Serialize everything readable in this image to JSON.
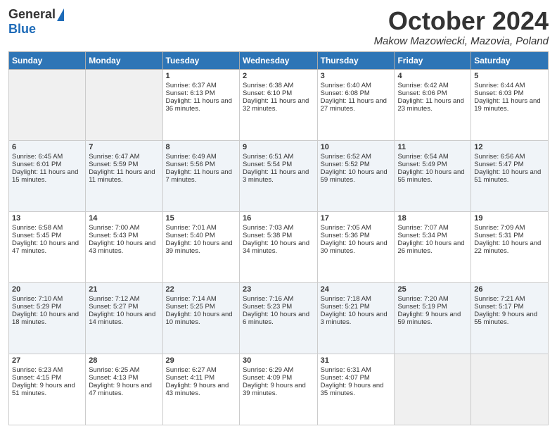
{
  "logo": {
    "general": "General",
    "blue": "Blue"
  },
  "header": {
    "month": "October 2024",
    "location": "Makow Mazowiecki, Mazovia, Poland"
  },
  "weekdays": [
    "Sunday",
    "Monday",
    "Tuesday",
    "Wednesday",
    "Thursday",
    "Friday",
    "Saturday"
  ],
  "weeks": [
    [
      {
        "day": "",
        "sunrise": "",
        "sunset": "",
        "daylight": ""
      },
      {
        "day": "",
        "sunrise": "",
        "sunset": "",
        "daylight": ""
      },
      {
        "day": "1",
        "sunrise": "Sunrise: 6:37 AM",
        "sunset": "Sunset: 6:13 PM",
        "daylight": "Daylight: 11 hours and 36 minutes."
      },
      {
        "day": "2",
        "sunrise": "Sunrise: 6:38 AM",
        "sunset": "Sunset: 6:10 PM",
        "daylight": "Daylight: 11 hours and 32 minutes."
      },
      {
        "day": "3",
        "sunrise": "Sunrise: 6:40 AM",
        "sunset": "Sunset: 6:08 PM",
        "daylight": "Daylight: 11 hours and 27 minutes."
      },
      {
        "day": "4",
        "sunrise": "Sunrise: 6:42 AM",
        "sunset": "Sunset: 6:06 PM",
        "daylight": "Daylight: 11 hours and 23 minutes."
      },
      {
        "day": "5",
        "sunrise": "Sunrise: 6:44 AM",
        "sunset": "Sunset: 6:03 PM",
        "daylight": "Daylight: 11 hours and 19 minutes."
      }
    ],
    [
      {
        "day": "6",
        "sunrise": "Sunrise: 6:45 AM",
        "sunset": "Sunset: 6:01 PM",
        "daylight": "Daylight: 11 hours and 15 minutes."
      },
      {
        "day": "7",
        "sunrise": "Sunrise: 6:47 AM",
        "sunset": "Sunset: 5:59 PM",
        "daylight": "Daylight: 11 hours and 11 minutes."
      },
      {
        "day": "8",
        "sunrise": "Sunrise: 6:49 AM",
        "sunset": "Sunset: 5:56 PM",
        "daylight": "Daylight: 11 hours and 7 minutes."
      },
      {
        "day": "9",
        "sunrise": "Sunrise: 6:51 AM",
        "sunset": "Sunset: 5:54 PM",
        "daylight": "Daylight: 11 hours and 3 minutes."
      },
      {
        "day": "10",
        "sunrise": "Sunrise: 6:52 AM",
        "sunset": "Sunset: 5:52 PM",
        "daylight": "Daylight: 10 hours and 59 minutes."
      },
      {
        "day": "11",
        "sunrise": "Sunrise: 6:54 AM",
        "sunset": "Sunset: 5:49 PM",
        "daylight": "Daylight: 10 hours and 55 minutes."
      },
      {
        "day": "12",
        "sunrise": "Sunrise: 6:56 AM",
        "sunset": "Sunset: 5:47 PM",
        "daylight": "Daylight: 10 hours and 51 minutes."
      }
    ],
    [
      {
        "day": "13",
        "sunrise": "Sunrise: 6:58 AM",
        "sunset": "Sunset: 5:45 PM",
        "daylight": "Daylight: 10 hours and 47 minutes."
      },
      {
        "day": "14",
        "sunrise": "Sunrise: 7:00 AM",
        "sunset": "Sunset: 5:43 PM",
        "daylight": "Daylight: 10 hours and 43 minutes."
      },
      {
        "day": "15",
        "sunrise": "Sunrise: 7:01 AM",
        "sunset": "Sunset: 5:40 PM",
        "daylight": "Daylight: 10 hours and 39 minutes."
      },
      {
        "day": "16",
        "sunrise": "Sunrise: 7:03 AM",
        "sunset": "Sunset: 5:38 PM",
        "daylight": "Daylight: 10 hours and 34 minutes."
      },
      {
        "day": "17",
        "sunrise": "Sunrise: 7:05 AM",
        "sunset": "Sunset: 5:36 PM",
        "daylight": "Daylight: 10 hours and 30 minutes."
      },
      {
        "day": "18",
        "sunrise": "Sunrise: 7:07 AM",
        "sunset": "Sunset: 5:34 PM",
        "daylight": "Daylight: 10 hours and 26 minutes."
      },
      {
        "day": "19",
        "sunrise": "Sunrise: 7:09 AM",
        "sunset": "Sunset: 5:31 PM",
        "daylight": "Daylight: 10 hours and 22 minutes."
      }
    ],
    [
      {
        "day": "20",
        "sunrise": "Sunrise: 7:10 AM",
        "sunset": "Sunset: 5:29 PM",
        "daylight": "Daylight: 10 hours and 18 minutes."
      },
      {
        "day": "21",
        "sunrise": "Sunrise: 7:12 AM",
        "sunset": "Sunset: 5:27 PM",
        "daylight": "Daylight: 10 hours and 14 minutes."
      },
      {
        "day": "22",
        "sunrise": "Sunrise: 7:14 AM",
        "sunset": "Sunset: 5:25 PM",
        "daylight": "Daylight: 10 hours and 10 minutes."
      },
      {
        "day": "23",
        "sunrise": "Sunrise: 7:16 AM",
        "sunset": "Sunset: 5:23 PM",
        "daylight": "Daylight: 10 hours and 6 minutes."
      },
      {
        "day": "24",
        "sunrise": "Sunrise: 7:18 AM",
        "sunset": "Sunset: 5:21 PM",
        "daylight": "Daylight: 10 hours and 3 minutes."
      },
      {
        "day": "25",
        "sunrise": "Sunrise: 7:20 AM",
        "sunset": "Sunset: 5:19 PM",
        "daylight": "Daylight: 9 hours and 59 minutes."
      },
      {
        "day": "26",
        "sunrise": "Sunrise: 7:21 AM",
        "sunset": "Sunset: 5:17 PM",
        "daylight": "Daylight: 9 hours and 55 minutes."
      }
    ],
    [
      {
        "day": "27",
        "sunrise": "Sunrise: 6:23 AM",
        "sunset": "Sunset: 4:15 PM",
        "daylight": "Daylight: 9 hours and 51 minutes."
      },
      {
        "day": "28",
        "sunrise": "Sunrise: 6:25 AM",
        "sunset": "Sunset: 4:13 PM",
        "daylight": "Daylight: 9 hours and 47 minutes."
      },
      {
        "day": "29",
        "sunrise": "Sunrise: 6:27 AM",
        "sunset": "Sunset: 4:11 PM",
        "daylight": "Daylight: 9 hours and 43 minutes."
      },
      {
        "day": "30",
        "sunrise": "Sunrise: 6:29 AM",
        "sunset": "Sunset: 4:09 PM",
        "daylight": "Daylight: 9 hours and 39 minutes."
      },
      {
        "day": "31",
        "sunrise": "Sunrise: 6:31 AM",
        "sunset": "Sunset: 4:07 PM",
        "daylight": "Daylight: 9 hours and 35 minutes."
      },
      {
        "day": "",
        "sunrise": "",
        "sunset": "",
        "daylight": ""
      },
      {
        "day": "",
        "sunrise": "",
        "sunset": "",
        "daylight": ""
      }
    ]
  ]
}
